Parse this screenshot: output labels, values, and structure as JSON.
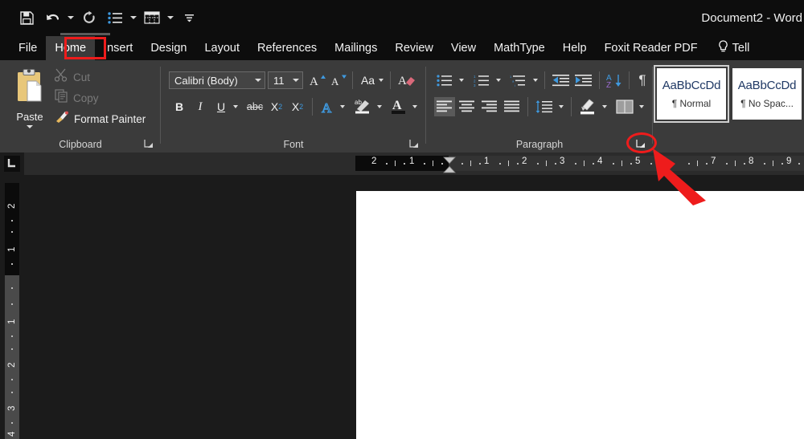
{
  "window": {
    "title": "Document2  -  Word"
  },
  "quick_access": {
    "items": [
      {
        "name": "save-icon",
        "label": "Save",
        "caret": false
      },
      {
        "name": "undo-icon",
        "label": "Undo",
        "caret": true
      },
      {
        "name": "redo-icon",
        "label": "Redo",
        "caret": false
      },
      {
        "name": "bullets-icon",
        "label": "Bullets",
        "caret": true
      },
      {
        "name": "table-icon",
        "label": "Table",
        "caret": true
      },
      {
        "name": "customize-quick-access-icon",
        "label": "Customize Quick Access Toolbar",
        "caret": false
      }
    ]
  },
  "tabs": {
    "items": [
      {
        "label": "File",
        "active": false
      },
      {
        "label": "Home",
        "active": true
      },
      {
        "label": "Insert",
        "active": false
      },
      {
        "label": "Design",
        "active": false
      },
      {
        "label": "Layout",
        "active": false
      },
      {
        "label": "References",
        "active": false
      },
      {
        "label": "Mailings",
        "active": false
      },
      {
        "label": "Review",
        "active": false
      },
      {
        "label": "View",
        "active": false
      },
      {
        "label": "MathType",
        "active": false
      },
      {
        "label": "Help",
        "active": false
      },
      {
        "label": "Foxit Reader PDF",
        "active": false
      }
    ],
    "tell_me": "Tell"
  },
  "ribbon": {
    "clipboard": {
      "label": "Clipboard",
      "paste": "Paste",
      "cut": "Cut",
      "copy": "Copy",
      "format_painter": "Format Painter",
      "dialog_launcher": "Clipboard dialog launcher"
    },
    "font": {
      "label": "Font",
      "font_name": "Calibri (Body)",
      "font_size": "11",
      "grow_font": "Grow Font",
      "shrink_font": "Shrink Font",
      "change_case": "Aa",
      "clear_formatting": "Clear All Formatting",
      "bold": "B",
      "italic": "I",
      "underline": "U",
      "strikethrough": "abc",
      "subscript": "X",
      "subscript_sub": "2",
      "superscript": "X",
      "superscript_sup": "2",
      "text_effects": "A",
      "text_highlight": "ab",
      "font_color": "A",
      "dialog_launcher": "Font dialog launcher"
    },
    "paragraph": {
      "label": "Paragraph",
      "bullets": "Bullets",
      "numbering": "Numbering",
      "multilevel_list": "Multilevel List",
      "decrease_indent": "Decrease Indent",
      "increase_indent": "Increase Indent",
      "sort": "Sort",
      "show_marks": "¶",
      "align_left": "Align Left",
      "align_center": "Center",
      "align_right": "Align Right",
      "justify": "Justify",
      "line_spacing": "Line and Paragraph Spacing",
      "shading": "Shading",
      "borders": "Borders",
      "dialog_launcher": "Paragraph dialog launcher"
    },
    "styles": {
      "items": [
        {
          "sample": "AaBbCcDd",
          "name": "¶ Normal",
          "selected": true
        },
        {
          "sample": "AaBbCcDd",
          "name": "¶ No Spac...",
          "selected": false
        }
      ]
    }
  },
  "rulers": {
    "tab_selector": "L",
    "horizontal_ticks": [
      "2",
      "1",
      "1",
      "2",
      "3",
      "4",
      "5",
      "7",
      "8",
      "9"
    ],
    "vertical_ticks": [
      "2",
      "1",
      "1",
      "2",
      "3",
      "4"
    ]
  },
  "annotations": {
    "highlight_tab": "Home",
    "circled_control": "Paragraph dialog launcher",
    "arrow_color": "#ee1c1c"
  }
}
